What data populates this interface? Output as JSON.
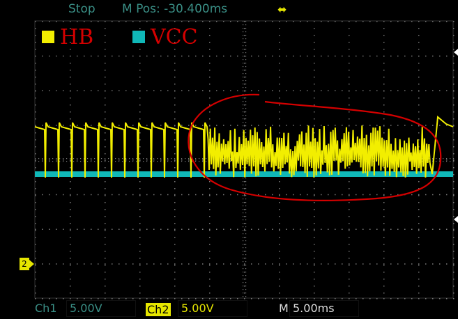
{
  "status": {
    "run_state": "Stop",
    "position_label": "M Pos: -30.400ms",
    "interface_icon": "usb-icon"
  },
  "legend": [
    {
      "name": "HB",
      "color": "#f2ee00"
    },
    {
      "name": "VCC",
      "color": "#10b8b8"
    }
  ],
  "channel_marker": "2",
  "footer": {
    "ch1_label": "Ch1",
    "ch1_value": "5.00V",
    "ch2_label": "Ch2",
    "ch2_value": "5.00V",
    "m_label": "M",
    "m_value": "5.00ms"
  },
  "colors": {
    "grid": "#7a7a7a",
    "trace_hb": "#f2ee00",
    "trace_vcc": "#10b8b8",
    "annotation": "#d40000",
    "status_text": "#3a8f86"
  }
}
